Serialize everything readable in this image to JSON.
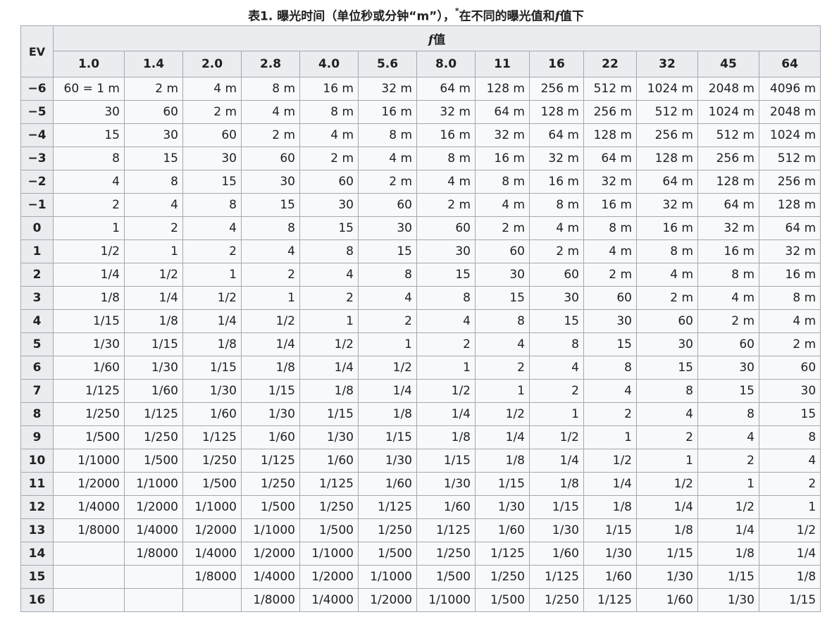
{
  "caption": {
    "prefix": "表1. 曝光时间（单位秒或分钟“m”），",
    "mark": "*",
    "mid": "在不同的曝光值和",
    "f": "f",
    "suffix": "值下"
  },
  "table": {
    "ev_header": "EV",
    "fgroup_f": "f",
    "fgroup_text": "值",
    "fstops": [
      "1.0",
      "1.4",
      "2.0",
      "2.8",
      "4.0",
      "5.6",
      "8.0",
      "11",
      "16",
      "22",
      "32",
      "45",
      "64"
    ],
    "rows": [
      {
        "ev": "−6",
        "cells": [
          "60 = 1 m",
          "2 m",
          "4 m",
          "8 m",
          "16 m",
          "32 m",
          "64 m",
          "128 m",
          "256 m",
          "512 m",
          "1024 m",
          "2048 m",
          "4096 m"
        ]
      },
      {
        "ev": "−5",
        "cells": [
          "30",
          "60",
          "2 m",
          "4 m",
          "8 m",
          "16 m",
          "32 m",
          "64 m",
          "128 m",
          "256 m",
          "512 m",
          "1024 m",
          "2048 m"
        ]
      },
      {
        "ev": "−4",
        "cells": [
          "15",
          "30",
          "60",
          "2 m",
          "4 m",
          "8 m",
          "16 m",
          "32 m",
          "64 m",
          "128 m",
          "256 m",
          "512 m",
          "1024 m"
        ]
      },
      {
        "ev": "−3",
        "cells": [
          "8",
          "15",
          "30",
          "60",
          "2 m",
          "4 m",
          "8 m",
          "16 m",
          "32 m",
          "64 m",
          "128 m",
          "256 m",
          "512 m"
        ]
      },
      {
        "ev": "−2",
        "cells": [
          "4",
          "8",
          "15",
          "30",
          "60",
          "2 m",
          "4 m",
          "8 m",
          "16 m",
          "32 m",
          "64 m",
          "128 m",
          "256 m"
        ]
      },
      {
        "ev": "−1",
        "cells": [
          "2",
          "4",
          "8",
          "15",
          "30",
          "60",
          "2 m",
          "4 m",
          "8 m",
          "16 m",
          "32 m",
          "64 m",
          "128 m"
        ]
      },
      {
        "ev": "0",
        "cells": [
          "1",
          "2",
          "4",
          "8",
          "15",
          "30",
          "60",
          "2 m",
          "4 m",
          "8 m",
          "16 m",
          "32 m",
          "64 m"
        ]
      },
      {
        "ev": "1",
        "cells": [
          "1/2",
          "1",
          "2",
          "4",
          "8",
          "15",
          "30",
          "60",
          "2 m",
          "4 m",
          "8 m",
          "16 m",
          "32 m"
        ]
      },
      {
        "ev": "2",
        "cells": [
          "1/4",
          "1/2",
          "1",
          "2",
          "4",
          "8",
          "15",
          "30",
          "60",
          "2 m",
          "4 m",
          "8 m",
          "16 m"
        ]
      },
      {
        "ev": "3",
        "cells": [
          "1/8",
          "1/4",
          "1/2",
          "1",
          "2",
          "4",
          "8",
          "15",
          "30",
          "60",
          "2 m",
          "4 m",
          "8 m"
        ]
      },
      {
        "ev": "4",
        "cells": [
          "1/15",
          "1/8",
          "1/4",
          "1/2",
          "1",
          "2",
          "4",
          "8",
          "15",
          "30",
          "60",
          "2 m",
          "4 m"
        ]
      },
      {
        "ev": "5",
        "cells": [
          "1/30",
          "1/15",
          "1/8",
          "1/4",
          "1/2",
          "1",
          "2",
          "4",
          "8",
          "15",
          "30",
          "60",
          "2 m"
        ]
      },
      {
        "ev": "6",
        "cells": [
          "1/60",
          "1/30",
          "1/15",
          "1/8",
          "1/4",
          "1/2",
          "1",
          "2",
          "4",
          "8",
          "15",
          "30",
          "60"
        ]
      },
      {
        "ev": "7",
        "cells": [
          "1/125",
          "1/60",
          "1/30",
          "1/15",
          "1/8",
          "1/4",
          "1/2",
          "1",
          "2",
          "4",
          "8",
          "15",
          "30"
        ]
      },
      {
        "ev": "8",
        "cells": [
          "1/250",
          "1/125",
          "1/60",
          "1/30",
          "1/15",
          "1/8",
          "1/4",
          "1/2",
          "1",
          "2",
          "4",
          "8",
          "15"
        ]
      },
      {
        "ev": "9",
        "cells": [
          "1/500",
          "1/250",
          "1/125",
          "1/60",
          "1/30",
          "1/15",
          "1/8",
          "1/4",
          "1/2",
          "1",
          "2",
          "4",
          "8"
        ]
      },
      {
        "ev": "10",
        "cells": [
          "1/1000",
          "1/500",
          "1/250",
          "1/125",
          "1/60",
          "1/30",
          "1/15",
          "1/8",
          "1/4",
          "1/2",
          "1",
          "2",
          "4"
        ]
      },
      {
        "ev": "11",
        "cells": [
          "1/2000",
          "1/1000",
          "1/500",
          "1/250",
          "1/125",
          "1/60",
          "1/30",
          "1/15",
          "1/8",
          "1/4",
          "1/2",
          "1",
          "2"
        ]
      },
      {
        "ev": "12",
        "cells": [
          "1/4000",
          "1/2000",
          "1/1000",
          "1/500",
          "1/250",
          "1/125",
          "1/60",
          "1/30",
          "1/15",
          "1/8",
          "1/4",
          "1/2",
          "1"
        ]
      },
      {
        "ev": "13",
        "cells": [
          "1/8000",
          "1/4000",
          "1/2000",
          "1/1000",
          "1/500",
          "1/250",
          "1/125",
          "1/60",
          "1/30",
          "1/15",
          "1/8",
          "1/4",
          "1/2"
        ]
      },
      {
        "ev": "14",
        "cells": [
          "",
          "1/8000",
          "1/4000",
          "1/2000",
          "1/1000",
          "1/500",
          "1/250",
          "1/125",
          "1/60",
          "1/30",
          "1/15",
          "1/8",
          "1/4"
        ]
      },
      {
        "ev": "15",
        "cells": [
          "",
          "",
          "1/8000",
          "1/4000",
          "1/2000",
          "1/1000",
          "1/500",
          "1/250",
          "1/125",
          "1/60",
          "1/30",
          "1/15",
          "1/8"
        ]
      },
      {
        "ev": "16",
        "cells": [
          "",
          "",
          "",
          "1/8000",
          "1/4000",
          "1/2000",
          "1/1000",
          "1/500",
          "1/250",
          "1/125",
          "1/60",
          "1/30",
          "1/15"
        ]
      }
    ]
  }
}
